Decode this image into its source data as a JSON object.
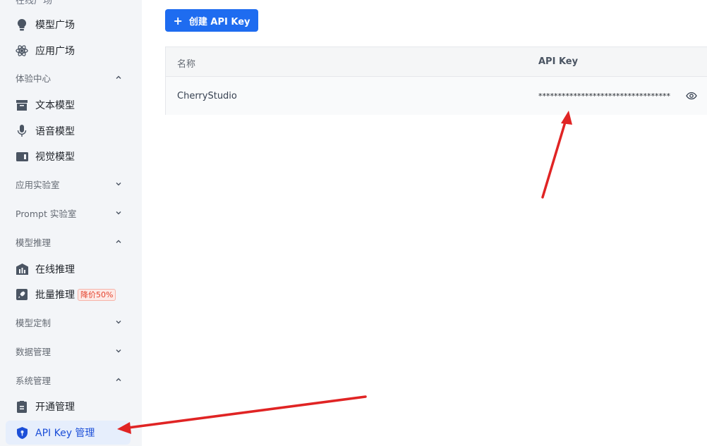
{
  "sidebar": {
    "cut_label": "在线广场",
    "items": {
      "model_square": "模型广场",
      "app_square": "应用广场",
      "text_model": "文本模型",
      "voice_model": "语音模型",
      "vision_model": "视觉模型",
      "online_inference": "在线推理",
      "batch_inference": "批量推理",
      "batch_badge": "降价50%",
      "activation": "开通管理",
      "api_key_mgmt": "API Key 管理"
    },
    "groups": {
      "experience": "体验中心",
      "app_lab": "应用实验室",
      "prompt_lab": "Prompt 实验室",
      "inference": "模型推理",
      "custom": "模型定制",
      "data": "数据管理",
      "system": "系统管理"
    }
  },
  "toolbar": {
    "create_label": "创建 API Key"
  },
  "table": {
    "headers": {
      "name": "名称",
      "key": "API Key"
    },
    "rows": [
      {
        "name": "CherryStudio",
        "key": "**********************************"
      }
    ]
  },
  "colors": {
    "accent": "#1e6cf0",
    "annotation_arrow": "#e02424",
    "badge": "#e4432d"
  }
}
